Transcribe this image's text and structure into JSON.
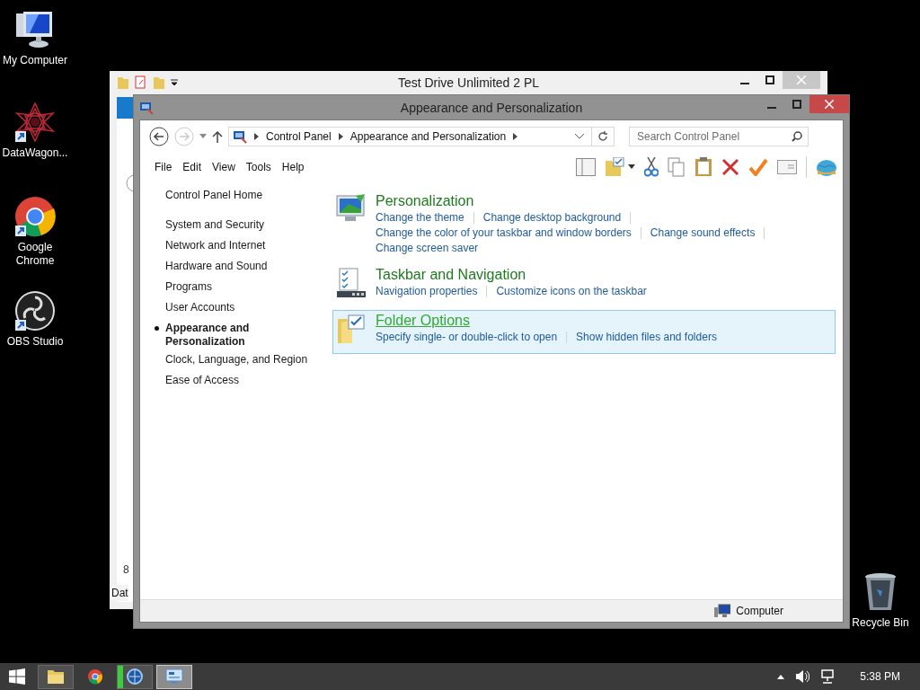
{
  "desktop_icons": [
    {
      "label": "My Computer",
      "kind": "computer"
    },
    {
      "label": "DataWagon...",
      "kind": "star"
    },
    {
      "label": "Google Chrome",
      "kind": "chrome"
    },
    {
      "label": "OBS Studio",
      "kind": "obs"
    },
    {
      "label": "Recycle Bin",
      "kind": "bin"
    }
  ],
  "back_window": {
    "title": "Test Drive Unlimited 2 PL",
    "cell_texts": [
      "8",
      "Dat"
    ]
  },
  "window": {
    "title": "Appearance and Personalization",
    "address": {
      "crumbs": [
        "Control Panel",
        "Appearance and Personalization"
      ]
    },
    "search": {
      "placeholder": "Search Control Panel"
    },
    "menu": [
      "File",
      "Edit",
      "View",
      "Tools",
      "Help"
    ],
    "sidebar": {
      "home": "Control Panel Home",
      "items": [
        {
          "label": "System and Security",
          "selected": false
        },
        {
          "label": "Network and Internet",
          "selected": false
        },
        {
          "label": "Hardware and Sound",
          "selected": false
        },
        {
          "label": "Programs",
          "selected": false
        },
        {
          "label": "User Accounts",
          "selected": false
        },
        {
          "label": "Appearance and Personalization",
          "selected": true
        },
        {
          "label": "Clock, Language, and Region",
          "selected": false
        },
        {
          "label": "Ease of Access",
          "selected": false
        }
      ]
    },
    "categories": [
      {
        "title": "Personalization",
        "kind": "personalization",
        "hovered": false,
        "link_rows": [
          [
            "Change the theme",
            "Change desktop background"
          ],
          [
            "Change the color of your taskbar and window borders",
            "Change sound effects"
          ],
          [
            "Change screen saver"
          ]
        ]
      },
      {
        "title": "Taskbar and Navigation",
        "kind": "taskbar",
        "hovered": false,
        "link_rows": [
          [
            "Navigation properties",
            "Customize icons on the taskbar"
          ]
        ]
      },
      {
        "title": "Folder Options",
        "kind": "folder",
        "hovered": true,
        "link_rows": [
          [
            "Specify single- or double-click to open",
            "Show hidden files and folders"
          ]
        ]
      }
    ],
    "status_bar": {
      "location": "Computer"
    }
  },
  "taskbar": {
    "apps": [
      {
        "kind": "explorer",
        "selected": false,
        "running": true
      },
      {
        "kind": "chrome",
        "selected": false,
        "running": false
      },
      {
        "kind": "app",
        "selected": false,
        "running": true
      },
      {
        "kind": "panel",
        "selected": true,
        "running": true
      }
    ],
    "clock": "5:38 PM"
  }
}
